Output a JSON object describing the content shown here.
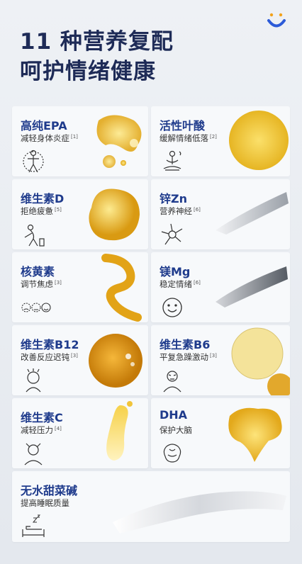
{
  "header": {
    "line1": "11 种营养复配",
    "line2": "呵护情绪健康"
  },
  "brand": {
    "primary": "#1e2b57",
    "accent": "#1f3b8c",
    "logo_blue": "#2d5bd8",
    "logo_orange": "#f2a21b"
  },
  "cards": [
    {
      "title": "高纯EPA",
      "sub": "减轻身体炎症",
      "ref": "[1]",
      "icon": "body-icon",
      "art": "oil-drops"
    },
    {
      "title": "活性叶酸",
      "sub": "缓解情绪低落",
      "ref": "[2]",
      "icon": "meditation-icon",
      "art": "yellow-disc"
    },
    {
      "title": "维生素D",
      "sub": "拒绝疲惫",
      "ref": "[5]",
      "icon": "tired-person-icon",
      "art": "oil-blob"
    },
    {
      "title": "锌Zn",
      "sub": "营养神经",
      "ref": "[6]",
      "icon": "neuron-icon",
      "art": "powder-swipe"
    },
    {
      "title": "核黄素",
      "sub": "调节焦虑",
      "ref": "[3]",
      "icon": "faces-icon",
      "art": "syrup-squiggle"
    },
    {
      "title": "镁Mg",
      "sub": "稳定情绪",
      "ref": "[6]",
      "icon": "smile-icon",
      "art": "powder-swipe-dark"
    },
    {
      "title": "维生素B12",
      "sub": "改善反应迟钝",
      "ref": "[3]",
      "icon": "confused-head-icon",
      "art": "amber-disc"
    },
    {
      "title": "维生素B6",
      "sub": "平复急躁激动",
      "ref": "[3]",
      "icon": "angry-person-icon",
      "art": "pale-discs"
    },
    {
      "title": "维生素C",
      "sub": "减轻压力",
      "ref": "[4]",
      "icon": "stressed-person-icon",
      "art": "drip"
    },
    {
      "title": "DHA",
      "sub": "保护大脑",
      "ref": "",
      "icon": "brain-icon",
      "art": "oil-splash"
    },
    {
      "title": "无水甜菜碱",
      "sub": "提高睡眠质量",
      "ref": "",
      "icon": "sleep-icon",
      "art": "white-powder"
    }
  ]
}
